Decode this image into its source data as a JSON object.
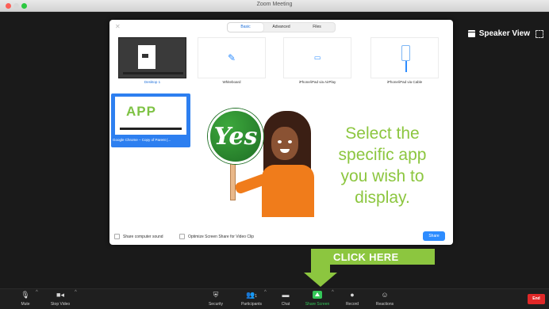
{
  "window": {
    "title": "Zoom Meeting"
  },
  "view": {
    "speaker_view_label": "Speaker View"
  },
  "share_dialog": {
    "tabs": [
      {
        "label": "Basic",
        "active": true
      },
      {
        "label": "Advanced",
        "active": false
      },
      {
        "label": "Files",
        "active": false
      }
    ],
    "options": [
      {
        "label": "Desktop 1",
        "icon": "desktop-thumbnail"
      },
      {
        "label": "Whiteboard",
        "icon": "pencil-icon"
      },
      {
        "label": "iPhone/iPad via AirPlay",
        "icon": "airplay-icon"
      },
      {
        "label": "iPhone/iPad via Cable",
        "icon": "cable-icon"
      }
    ],
    "selected_app": {
      "thumb_text": "APP",
      "label": "Google Chrome – Copy of Parent (...",
      "selected": true
    },
    "footer": {
      "share_sound_label": "Share computer sound",
      "optimize_label": "Optimize Screen Share for Video Clip",
      "share_button_label": "Share"
    }
  },
  "annotation": {
    "sign_text": "Yes",
    "instruction_lines": [
      "Select the",
      "specific app",
      "you wish to",
      "display."
    ],
    "click_here_label": "CLICK HERE"
  },
  "toolbar": {
    "mute_label": "Mute",
    "stop_video_label": "Stop Video",
    "security_label": "Security",
    "participants_label": "Participants",
    "participants_count": "1",
    "chat_label": "Chat",
    "share_screen_label": "Share Screen",
    "record_label": "Record",
    "reactions_label": "Reactions",
    "end_label": "End"
  },
  "colors": {
    "accent": "#2d8cff",
    "annotation_green": "#8cc63f",
    "share_green": "#34c759",
    "end_red": "#e02828"
  }
}
